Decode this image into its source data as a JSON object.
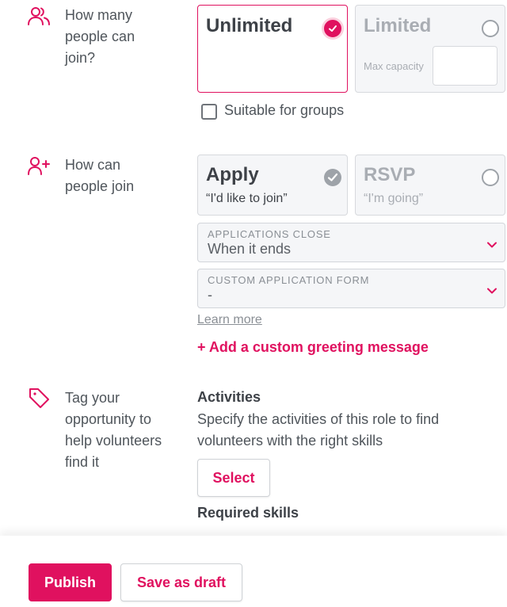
{
  "capacity": {
    "question": "How many people can join?",
    "unlimited_label": "Unlimited",
    "limited_label": "Limited",
    "max_capacity_placeholder": "Max capacity",
    "max_capacity_value": "",
    "groups_checkbox_label": "Suitable for groups",
    "groups_checked": false,
    "selected": "Unlimited"
  },
  "join_method": {
    "question": "How can people join",
    "apply_title": "Apply",
    "apply_sub": "“I'd like to join”",
    "rsvp_title": "RSVP",
    "rsvp_sub": "“I'm going”",
    "selected": "Apply",
    "applications_close_label": "APPLICATIONS CLOSE",
    "applications_close_value": "When it ends",
    "custom_form_label": "CUSTOM APPLICATION FORM",
    "custom_form_value": "-",
    "learn_more": "Learn more",
    "add_greeting": "+ Add a custom greeting message"
  },
  "tags": {
    "question": "Tag your opportunity to help volunteers find it",
    "activities_heading": "Activities",
    "activities_desc": "Specify the activities of this role to find volunteers with the right skills",
    "select_button": "Select",
    "required_skills_heading": "Required skills"
  },
  "footer": {
    "publish": "Publish",
    "save_draft": "Save as draft"
  },
  "colors": {
    "accent": "#e0115f",
    "text": "#4a4f55",
    "muted": "#a9adb3"
  },
  "icons": [
    "users-icon",
    "user-plus-icon",
    "tag-icon",
    "check-icon",
    "chevron-down-icon"
  ]
}
